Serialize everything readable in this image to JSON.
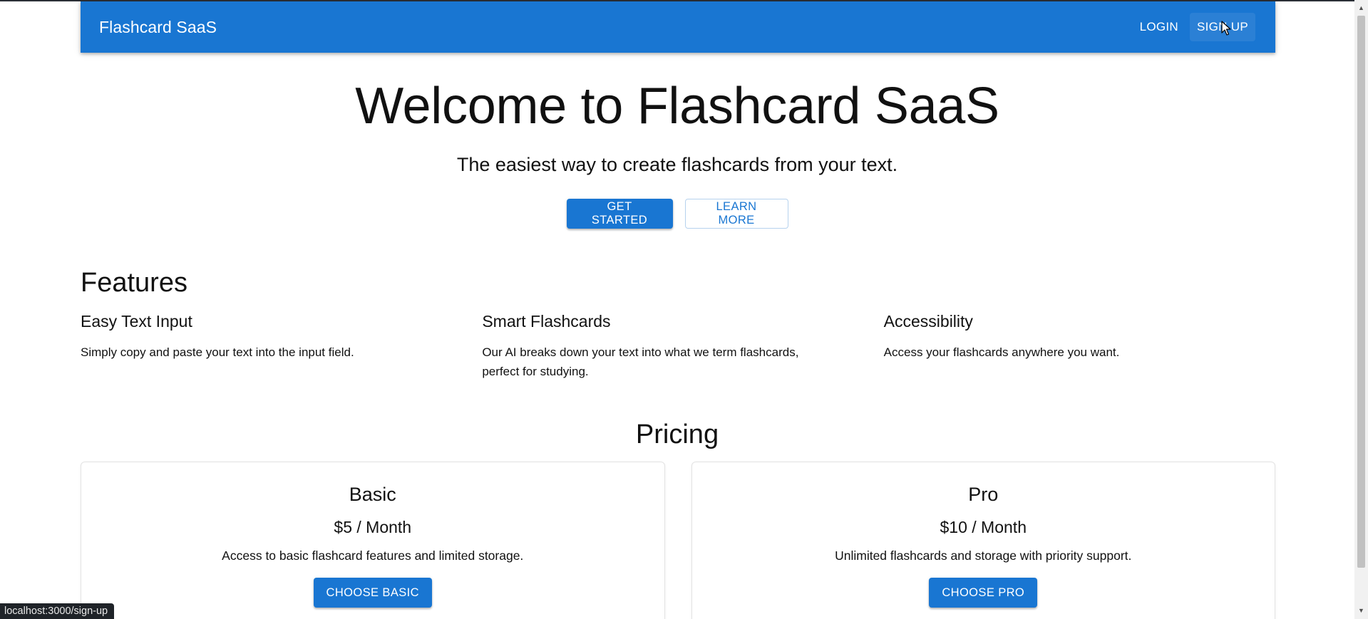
{
  "appbar": {
    "brand": "Flashcard SaaS",
    "login_label": "LOGIN",
    "signup_label": "SIGN UP"
  },
  "hero": {
    "title": "Welcome to Flashcard SaaS",
    "subtitle": "The easiest way to create flashcards from your text.",
    "get_started_label": "GET STARTED",
    "learn_more_label": "LEARN MORE"
  },
  "features": {
    "heading": "Features",
    "items": [
      {
        "title": "Easy Text Input",
        "description": "Simply copy and paste your text into the input field."
      },
      {
        "title": "Smart Flashcards",
        "description": "Our AI breaks down your text into what we term flashcards, perfect for studying."
      },
      {
        "title": "Accessibility",
        "description": "Access your flashcards anywhere you want."
      }
    ]
  },
  "pricing": {
    "heading": "Pricing",
    "plans": [
      {
        "name": "Basic",
        "price": "$5 / Month",
        "description": "Access to basic flashcard features and limited storage.",
        "button_label": "CHOOSE BASIC"
      },
      {
        "name": "Pro",
        "price": "$10 / Month",
        "description": "Unlimited flashcards and storage with priority support.",
        "button_label": "CHOOSE PRO"
      }
    ]
  },
  "status_bar": {
    "url": "localhost:3000/sign-up"
  },
  "colors": {
    "primary": "#1976d2",
    "outline_border": "#b6d2ee",
    "status_bar_bg": "#1f2328"
  },
  "icons": {
    "cursor": "arrow-cursor-icon",
    "scroll_up": "scroll-up-arrow-icon",
    "scroll_down": "scroll-down-arrow-icon"
  }
}
